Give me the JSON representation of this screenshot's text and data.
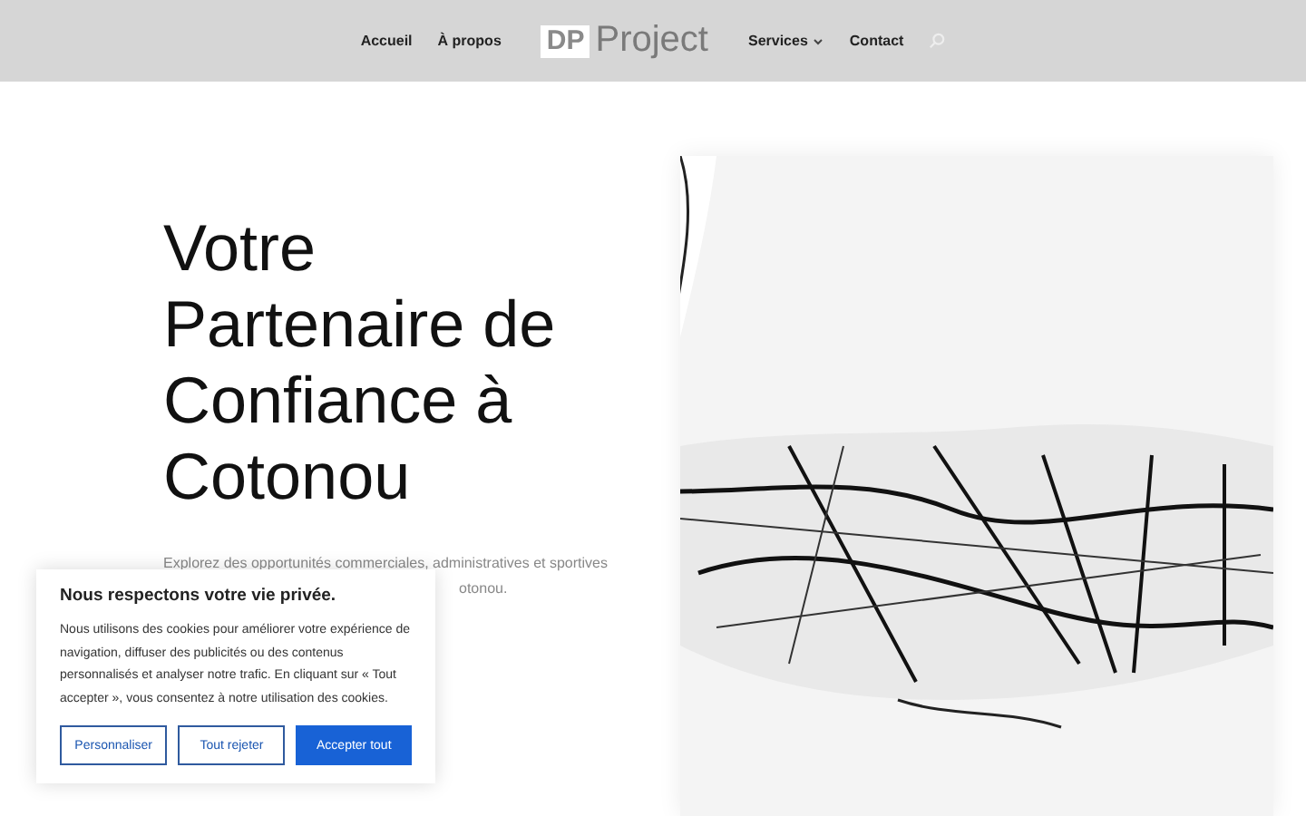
{
  "header": {
    "nav_left": [
      "Accueil",
      "À propos"
    ],
    "logo": {
      "mark": "DP",
      "word": "Project"
    },
    "nav_right": [
      {
        "label": "Services",
        "dropdown": true
      },
      {
        "label": "Contact",
        "dropdown": false
      }
    ]
  },
  "hero": {
    "heading": "Votre Partenaire de Confiance à Cotonou",
    "intro_line": "Explorez des opportunités commerciales, administratives et sportives",
    "intro_tail": "otonou."
  },
  "cookie_banner": {
    "title": "Nous respectons votre vie privée.",
    "text": "Nous utilisons des cookies pour améliorer votre expérience de navigation, diffuser des publicités ou des contenus personnalisés et analyser notre trafic. En cliquant sur « Tout accepter », vous consentez à notre utilisation des cookies.",
    "buttons": [
      {
        "label": "Personnaliser",
        "primary": false
      },
      {
        "label": "Tout rejeter",
        "primary": false
      },
      {
        "label": "Accepter tout",
        "primary": true
      }
    ]
  }
}
